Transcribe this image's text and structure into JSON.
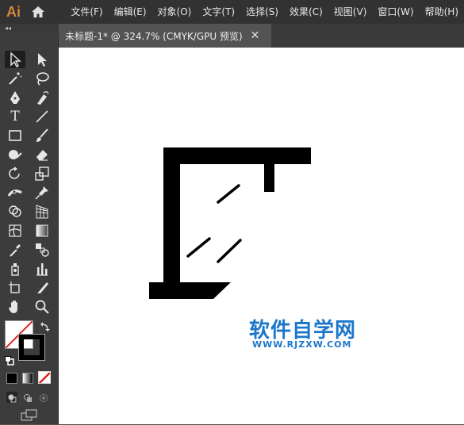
{
  "app": {
    "logo": "Ai",
    "home_icon": "home-icon"
  },
  "menu": [
    {
      "label": "文件(F)"
    },
    {
      "label": "编辑(E)"
    },
    {
      "label": "对象(O)"
    },
    {
      "label": "文字(T)"
    },
    {
      "label": "选择(S)"
    },
    {
      "label": "效果(C)"
    },
    {
      "label": "视图(V)"
    },
    {
      "label": "窗口(W)"
    },
    {
      "label": "帮助(H)"
    }
  ],
  "toolbar": {
    "grip": "◂◂",
    "tools": [
      "selection-tool-icon",
      "direct-selection-tool-icon",
      "magic-wand-tool-icon",
      "lasso-tool-icon",
      "pen-tool-icon",
      "curvature-tool-icon",
      "type-tool-icon",
      "line-segment-tool-icon",
      "rectangle-tool-icon",
      "paintbrush-tool-icon",
      "shaper-tool-icon",
      "eraser-tool-icon",
      "rotate-tool-icon",
      "scale-tool-icon",
      "width-tool-icon",
      "puppet-warp-tool-icon",
      "shape-builder-tool-icon",
      "perspective-grid-tool-icon",
      "mesh-tool-icon",
      "gradient-tool-icon",
      "eyedropper-tool-icon",
      "blend-tool-icon",
      "symbol-sprayer-tool-icon",
      "column-graph-tool-icon",
      "artboard-tool-icon",
      "slice-tool-icon",
      "hand-tool-icon",
      "zoom-tool-icon"
    ],
    "type_glyph": "T"
  },
  "document": {
    "tab_title": "未标题-1* @ 324.7% (CMYK/GPU 预览)",
    "close_glyph": "✕"
  },
  "watermark": {
    "title": "软件自学网",
    "url": "WWW.RJZXW.COM",
    "color": "#1c76c9"
  },
  "colors": {
    "accent": "#d6873a",
    "menubar": "#323232",
    "panel": "#3c3c3c"
  }
}
